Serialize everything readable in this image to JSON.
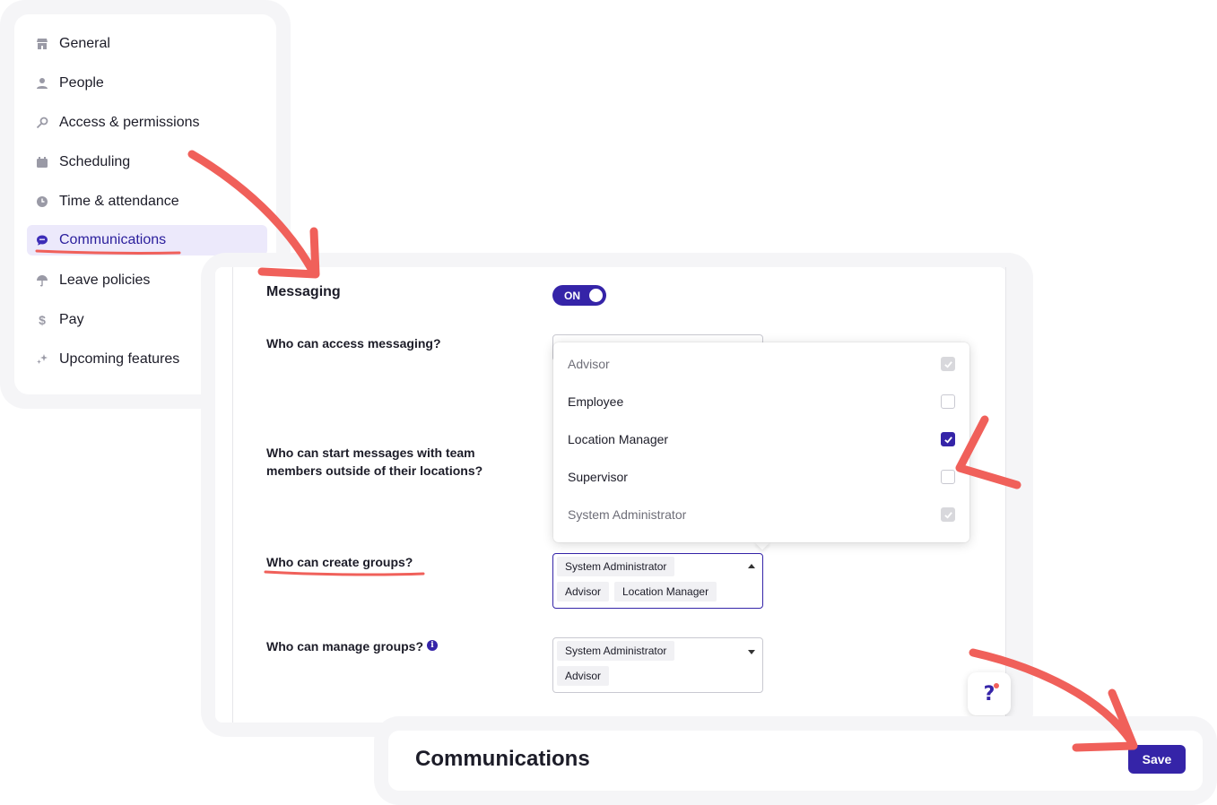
{
  "sidebar": {
    "items": [
      {
        "label": "General",
        "icon": "store-icon"
      },
      {
        "label": "People",
        "icon": "person-icon"
      },
      {
        "label": "Access & permissions",
        "icon": "key-icon"
      },
      {
        "label": "Scheduling",
        "icon": "calendar-icon"
      },
      {
        "label": "Time & attendance",
        "icon": "clock-icon"
      },
      {
        "label": "Communications",
        "icon": "chat-icon",
        "active": true
      },
      {
        "label": "Leave policies",
        "icon": "umbrella-icon"
      },
      {
        "label": "Pay",
        "icon": "dollar-icon"
      },
      {
        "label": "Upcoming features",
        "icon": "sparkle-icon"
      }
    ]
  },
  "messaging": {
    "title": "Messaging",
    "toggle_label": "ON",
    "toggle_on": true
  },
  "questions": {
    "access": "Who can access messaging?",
    "outside_locations": "Who can start messages with team members outside of their locations?",
    "create_groups": "Who can create groups?",
    "manage_groups": "Who can manage groups?"
  },
  "create_groups_select": {
    "chips": [
      "System Administrator",
      "Advisor",
      "Location Manager"
    ]
  },
  "manage_groups_select": {
    "chips": [
      "System Administrator",
      "Advisor"
    ]
  },
  "dropdown": {
    "options": [
      {
        "label": "Advisor",
        "state": "checked-disabled"
      },
      {
        "label": "Employee",
        "state": "unchecked"
      },
      {
        "label": "Location Manager",
        "state": "checked"
      },
      {
        "label": "Supervisor",
        "state": "unchecked"
      },
      {
        "label": "System Administrator",
        "state": "checked-disabled"
      }
    ]
  },
  "help": {
    "label": "?"
  },
  "footer": {
    "title": "Communications",
    "save_label": "Save"
  },
  "colors": {
    "accent": "#3524a8",
    "annotation": "#f0605a",
    "active_nav_bg": "#ece9fb"
  }
}
